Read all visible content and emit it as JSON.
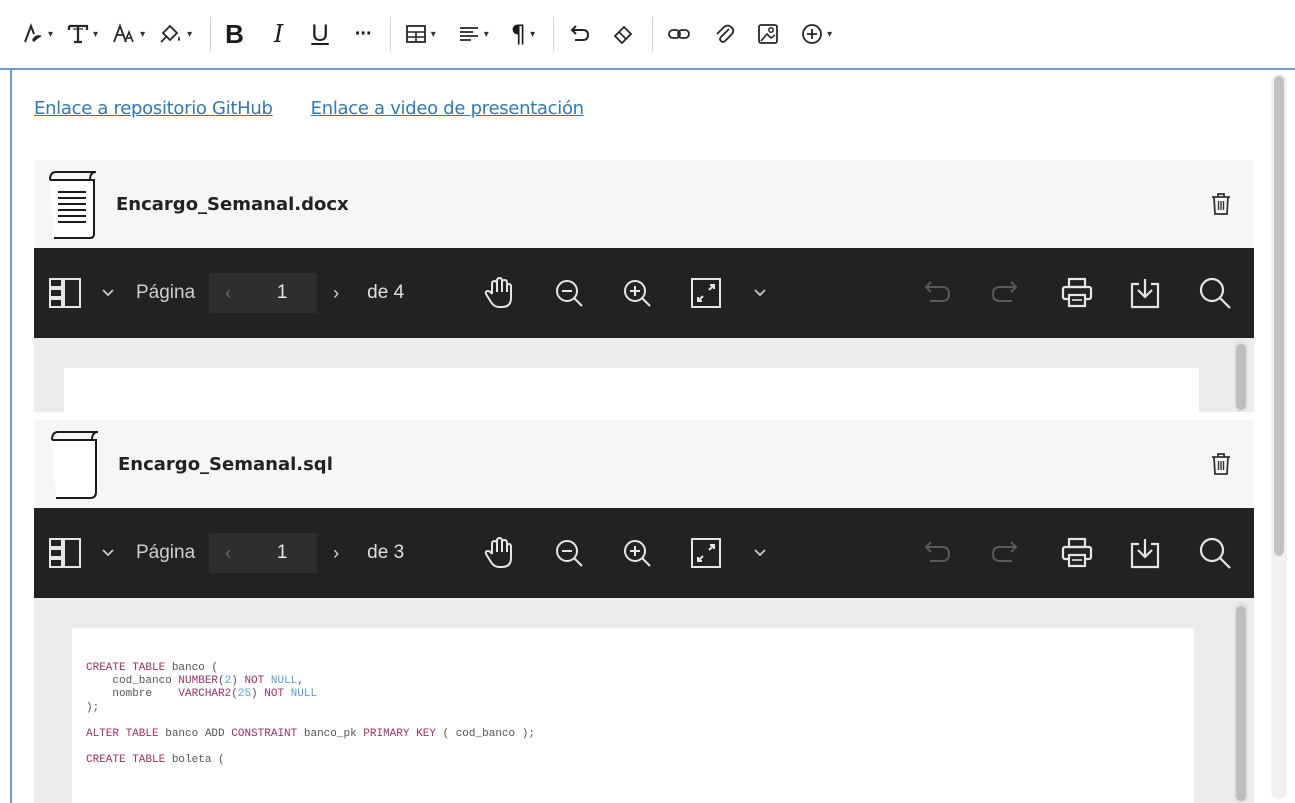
{
  "toolbar": {
    "items": [
      "text-style-icon",
      "font-family-icon",
      "font-size-icon",
      "paint-bucket-icon",
      "bold-icon",
      "italic-icon",
      "underline-icon",
      "more-options-icon",
      "table-icon",
      "align-icon",
      "paragraph-icon",
      "undo-icon",
      "eraser-icon",
      "link-icon",
      "paperclip-icon",
      "image-icon",
      "add-content-icon"
    ],
    "bold": "B",
    "italic": "I",
    "underline": "U",
    "more": "···",
    "paragraph": "¶"
  },
  "links": {
    "github": "Enlace a repositorio GitHub",
    "video": "Enlace a video de presentación"
  },
  "attachments": [
    {
      "filename": "Encargo_Semanal.docx",
      "viewer": {
        "page_label": "Página",
        "current_page": "1",
        "of_label": "de 4"
      }
    },
    {
      "filename": "Encargo_Semanal.sql",
      "viewer": {
        "page_label": "Página",
        "current_page": "1",
        "of_label": "de 3"
      }
    }
  ],
  "sql": {
    "l1_kw": "CREATE TABLE",
    "l1_rest": " banco (",
    "l2_a": "    cod_banco ",
    "l2_type": "NUMBER",
    "l2_b": "(",
    "l2_num": "2",
    "l2_c": ") ",
    "l2_not": "NOT",
    "l2_d": " ",
    "l2_null": "NULL",
    "l2_e": ",",
    "l3_a": "    nombre    ",
    "l3_type": "VARCHAR2",
    "l3_b": "(",
    "l3_num": "25",
    "l3_c": ") ",
    "l3_not": "NOT",
    "l3_d": " ",
    "l3_null": "NULL",
    "l4": ");",
    "l6_kw": "ALTER TABLE",
    "l6_a": " banco ADD ",
    "l6_kw2": "CONSTRAINT",
    "l6_b": " banco_pk ",
    "l6_kw3": "PRIMARY KEY",
    "l6_c": " ( cod_banco );",
    "l8_kw": "CREATE TABLE",
    "l8_rest": " boleta ("
  },
  "colors": {
    "toolbar_border": "#6b9ccc",
    "link": "#2e7ab8",
    "viewer_bar": "#222222",
    "sql_keyword": "#a0306b",
    "sql_literal": "#5aa0cf"
  }
}
